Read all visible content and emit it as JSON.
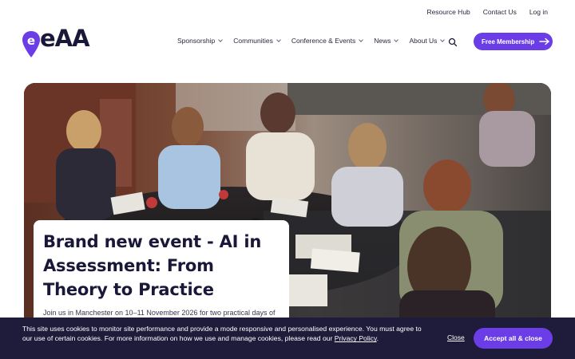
{
  "utility_nav": {
    "resource_hub": "Resource Hub",
    "contact_us": "Contact Us",
    "log_in": "Log in"
  },
  "logo": {
    "text": "eAA",
    "brand_color": "#6b3de6"
  },
  "main_nav": {
    "items": [
      {
        "label": "Sponsorship"
      },
      {
        "label": "Communities"
      },
      {
        "label": "Conference & Events"
      },
      {
        "label": "News"
      },
      {
        "label": "About Us"
      }
    ],
    "search_icon": "search-icon",
    "cta_label": "Free Membership",
    "cta_icon": "arrow-right-icon"
  },
  "hero": {
    "image_icon": "hero-photo",
    "title": "Brand new event - AI in Assessment: From Theory to Practice",
    "summary": "Join us in Manchester on 10–11 November 2026 for two practical days of"
  },
  "cookie_banner": {
    "text": "This site uses cookies to monitor site performance and provide a mode responsive and personalised experience. You must agree to our use of certain cookies. For more information on how we use and manage cookies, please read our",
    "policy_link": "Privacy Policy",
    "close_label": "Close",
    "accept_label": "Accept all & close"
  },
  "colors": {
    "accent": "#6b3de6",
    "dark": "#1e1b3b",
    "text": "#1a1838"
  }
}
